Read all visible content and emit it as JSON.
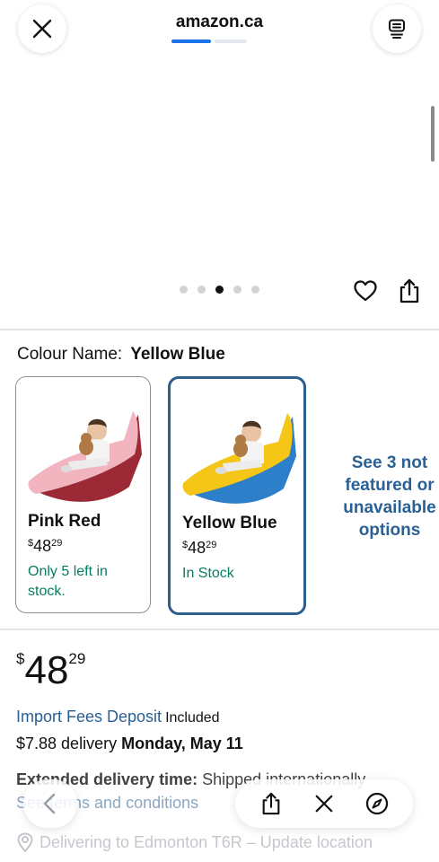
{
  "browser": {
    "site_title": "amazon.ca",
    "load_progress": 0.4
  },
  "carousel": {
    "dot_count": 5,
    "active_index": 2
  },
  "colour": {
    "label": "Colour Name:",
    "selected": "Yellow Blue"
  },
  "swatches": [
    {
      "name": "Pink Red",
      "price_currency": "$",
      "price_whole": "48",
      "price_fraction": "29",
      "stock": "Only 5 left in stock."
    },
    {
      "name": "Yellow Blue",
      "price_currency": "$",
      "price_whole": "48",
      "price_fraction": "29",
      "stock": "In Stock"
    }
  ],
  "see_more": "See 3 not featured or unavailable options",
  "price": {
    "currency": "$",
    "whole": "48",
    "fraction": "29"
  },
  "import_fees": {
    "link": "Import Fees Deposit",
    "status": "Included"
  },
  "delivery": {
    "prefix": "$7.88 delivery",
    "date": "Monday, May 11"
  },
  "extended": {
    "label": "Extended delivery time:",
    "text": "Shipped internationally"
  },
  "terms": "See terms and conditions",
  "location": "Delivering to Edmonton T6R – Update location",
  "colors": {
    "link": "#2b6095",
    "in_stock": "#067d62",
    "selected_border": "#2b5e8c",
    "progress": "#1a73e8"
  },
  "icons": {
    "close": "close-icon",
    "reader": "reader-icon",
    "heart": "heart-icon",
    "share": "share-icon",
    "back": "back-icon",
    "compass": "compass-icon",
    "location": "location-pin-icon"
  }
}
